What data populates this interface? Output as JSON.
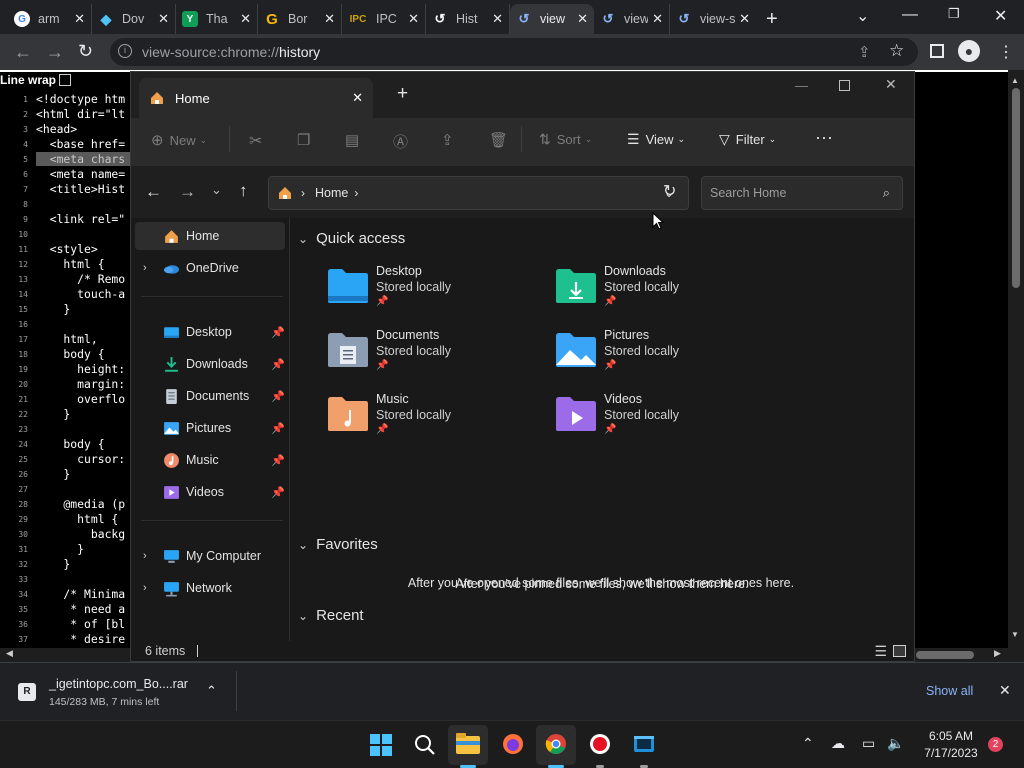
{
  "browser": {
    "tabs": [
      {
        "title": "arm",
        "icon": "google-icon",
        "color": "#ffffff"
      },
      {
        "title": "Dov",
        "icon": "diamond-icon",
        "color": "#4fc3f7"
      },
      {
        "title": "Tha",
        "icon": "sheets-icon",
        "color": "#0f9d58"
      },
      {
        "title": "Bor",
        "icon": "goodreads-icon",
        "color": "#f6b60a"
      },
      {
        "title": "IPC",
        "icon": "ipc-icon",
        "color": "#c8a400"
      },
      {
        "title": "Hist",
        "icon": "history-icon",
        "color": "#ffffff"
      },
      {
        "title": "view",
        "icon": "history-icon",
        "color": "#8ab4f8"
      },
      {
        "title": "view",
        "icon": "history-icon",
        "color": "#8ab4f8"
      },
      {
        "title": "view-so",
        "icon": "history-icon",
        "color": "#8ab4f8"
      }
    ],
    "url_prefix": "view-source:chrome://",
    "url_rest": "history",
    "line_wrap_label": "Line wrap"
  },
  "source_lines": [
    {
      "n": "1",
      "t": "<!doctype htm"
    },
    {
      "n": "2",
      "t": "<html dir=\"lt"
    },
    {
      "n": "3",
      "t": "<head>"
    },
    {
      "n": "4",
      "t": "  <base href="
    },
    {
      "n": "5",
      "t": "  <meta chars"
    },
    {
      "n": "6",
      "t": "  <meta name="
    },
    {
      "n": "7",
      "t": "  <title>Hist"
    },
    {
      "n": "8",
      "t": ""
    },
    {
      "n": "9",
      "t": "  <link rel=\""
    },
    {
      "n": "10",
      "t": ""
    },
    {
      "n": "11",
      "t": "  <style>"
    },
    {
      "n": "12",
      "t": "    html {"
    },
    {
      "n": "13",
      "t": "      /* Remo"
    },
    {
      "n": "14",
      "t": "      touch-a"
    },
    {
      "n": "15",
      "t": "    }"
    },
    {
      "n": "16",
      "t": ""
    },
    {
      "n": "17",
      "t": "    html,"
    },
    {
      "n": "18",
      "t": "    body {"
    },
    {
      "n": "19",
      "t": "      height:"
    },
    {
      "n": "20",
      "t": "      margin:"
    },
    {
      "n": "21",
      "t": "      overflo"
    },
    {
      "n": "22",
      "t": "    }"
    },
    {
      "n": "23",
      "t": ""
    },
    {
      "n": "24",
      "t": "    body {"
    },
    {
      "n": "25",
      "t": "      cursor:"
    },
    {
      "n": "26",
      "t": "    }"
    },
    {
      "n": "27",
      "t": ""
    },
    {
      "n": "28",
      "t": "    @media (p"
    },
    {
      "n": "29",
      "t": "      html {"
    },
    {
      "n": "30",
      "t": "        backg"
    },
    {
      "n": "31",
      "t": "      }"
    },
    {
      "n": "32",
      "t": "    }"
    },
    {
      "n": "33",
      "t": ""
    },
    {
      "n": "34",
      "t": "    /* Minima"
    },
    {
      "n": "35",
      "t": "     * need a"
    },
    {
      "n": "36",
      "t": "     * of [bl"
    },
    {
      "n": "37",
      "t": "     * desire"
    }
  ],
  "explorer": {
    "tab_title": "Home",
    "commands": {
      "new": "New",
      "sort": "Sort",
      "view": "View",
      "filter": "Filter"
    },
    "breadcrumb": "Home",
    "search_placeholder": "Search Home",
    "nav": {
      "home": "Home",
      "onedrive": "OneDrive",
      "pinned": [
        "Desktop",
        "Downloads",
        "Documents",
        "Pictures",
        "Music",
        "Videos"
      ],
      "mycomputer": "My Computer",
      "network": "Network"
    },
    "sections": {
      "quick_access": "Quick access",
      "favorites": "Favorites",
      "recent": "Recent"
    },
    "tiles": [
      {
        "name": "Desktop",
        "sub": "Stored locally",
        "icon": "desktop-folder-icon",
        "color": "#2aa4f4"
      },
      {
        "name": "Downloads",
        "sub": "Stored locally",
        "icon": "downloads-folder-icon",
        "color": "#1ec08f"
      },
      {
        "name": "Documents",
        "sub": "Stored locally",
        "icon": "documents-folder-icon",
        "color": "#8d9db3"
      },
      {
        "name": "Pictures",
        "sub": "Stored locally",
        "icon": "pictures-folder-icon",
        "color": "#3ba4f6"
      },
      {
        "name": "Music",
        "sub": "Stored locally",
        "icon": "music-folder-icon",
        "color": "#f2a06b"
      },
      {
        "name": "Videos",
        "sub": "Stored locally",
        "icon": "videos-folder-icon",
        "color": "#9c6be8"
      }
    ],
    "favorites_empty": "After you've pinned some files, we'll show them here.",
    "recent_empty": "After you've opened some files, we'll show the most recent ones here.",
    "status": "6 items"
  },
  "download": {
    "filename": "_igetintopc.com_Bo....rar",
    "progress": "145/283 MB, 7 mins left",
    "show_all": "Show all"
  },
  "taskbar": {
    "time": "6:05 AM",
    "date": "7/17/2023",
    "badge": "2"
  }
}
